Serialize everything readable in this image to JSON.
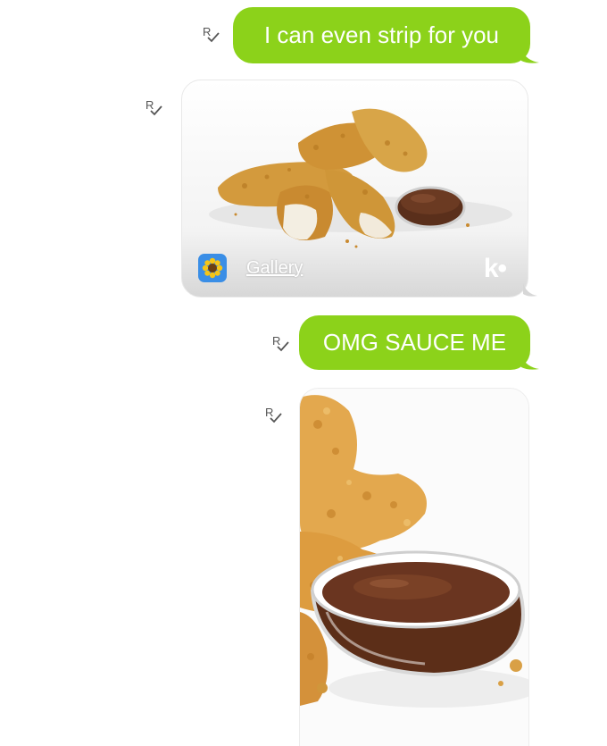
{
  "messages": [
    {
      "type": "text",
      "text": "I can even strip for you",
      "receipt": "read-receipt-icon"
    },
    {
      "type": "gallery-card",
      "image": "chicken-strips-with-dip-image",
      "source_label": "Gallery",
      "source_icon": "sunflower-icon",
      "brand": "k•",
      "receipt": "read-receipt-icon"
    },
    {
      "type": "text",
      "text": "OMG SAUCE ME",
      "receipt": "read-receipt-icon"
    },
    {
      "type": "image",
      "image": "sauce-cup-closeup-image",
      "receipt": "read-receipt-icon"
    }
  ],
  "colors": {
    "bubble": "#8cd21a",
    "bubble_text": "#ffffff",
    "background": "#ffffff"
  }
}
